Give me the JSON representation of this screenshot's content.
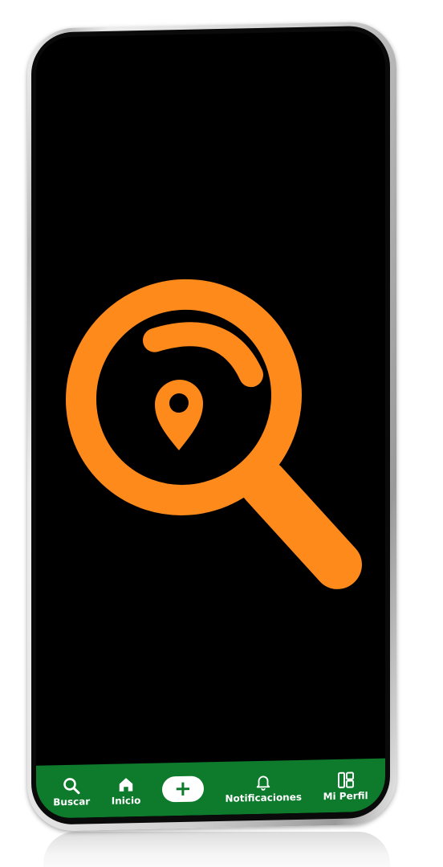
{
  "app": {
    "accent_color": "#FF8A1C",
    "nav_color": "#0D7A2C",
    "logo_icon": "magnifier-location-pin-icon"
  },
  "bottom_nav": {
    "items": [
      {
        "label": "Buscar",
        "icon": "search-icon"
      },
      {
        "label": "Inicio",
        "icon": "home-icon"
      },
      {
        "label": "+",
        "icon": "plus-icon"
      },
      {
        "label": "Notificaciones",
        "icon": "bell-icon"
      },
      {
        "label": "Mi Perfil",
        "icon": "layout-icon"
      }
    ]
  }
}
